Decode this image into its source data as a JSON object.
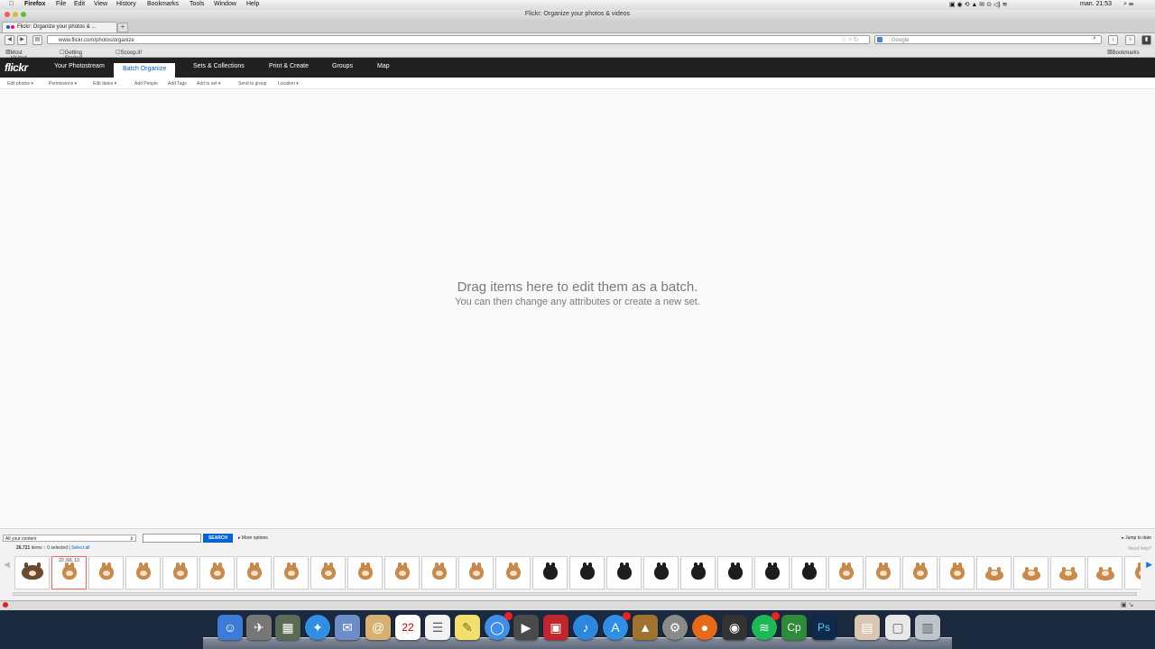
{
  "menubar": {
    "apple": "",
    "app": "Firefox",
    "items": [
      "File",
      "Edit",
      "View",
      "History",
      "Bookmarks",
      "Tools",
      "Window",
      "Help"
    ],
    "clock": "man. 21:53"
  },
  "window": {
    "title": "Flickr: Organize your photos & videos"
  },
  "tab": {
    "label": "Flickr: Organize your photos & ...",
    "new_tab": "+"
  },
  "nav": {
    "url": "www.flickr.com/photos/organize",
    "search_placeholder": "Google"
  },
  "bookmarks": {
    "most_visited": "Most Visited ▾",
    "getting_started": "Getting Started",
    "scoopit": "Scoop.it!",
    "bookmarks": "Bookmarks"
  },
  "flickr": {
    "logo": "flickr",
    "tabs": [
      "Your Photostream",
      "Batch Organize",
      "Sets & Collections",
      "Print & Create",
      "Groups",
      "Map"
    ],
    "active_tab": "Batch Organize",
    "subnav": [
      "Edit photos ▾",
      "Permissions ▾",
      "Edit dates ▾",
      "Add People",
      "Add Tags",
      "Add to set ▾",
      "Send to group",
      "Location ▾"
    ]
  },
  "canvas": {
    "line1": "Drag items here to edit them as a batch.",
    "line2": "You can then change any attributes or create a new set."
  },
  "organizer": {
    "scope": "All your content",
    "search_button": "SEARCH",
    "more_options": "More options",
    "jump_to_date": "Jump to date",
    "count": "26,721",
    "count_suffix": "items :: 0 selected |",
    "select_all": "Select all",
    "need_help": "Need help?",
    "first_date": "22 JUL 13"
  },
  "thumbnails": [
    "mixed",
    "orange-selected",
    "orange",
    "orange",
    "orange",
    "orange",
    "orange",
    "orange",
    "orange",
    "orange",
    "orange",
    "orange",
    "orange",
    "orange",
    "black",
    "black",
    "black",
    "black",
    "black",
    "black",
    "black",
    "black",
    "orange",
    "orange",
    "orange",
    "orange",
    "orange-lying",
    "orange-lying",
    "orange-lying",
    "orange-lying",
    "orange"
  ],
  "colors": {
    "flickr_blue": "#0063dc",
    "header": "#212121",
    "pom_orange": "#c8894a",
    "pom_black": "#1d1d1d"
  }
}
